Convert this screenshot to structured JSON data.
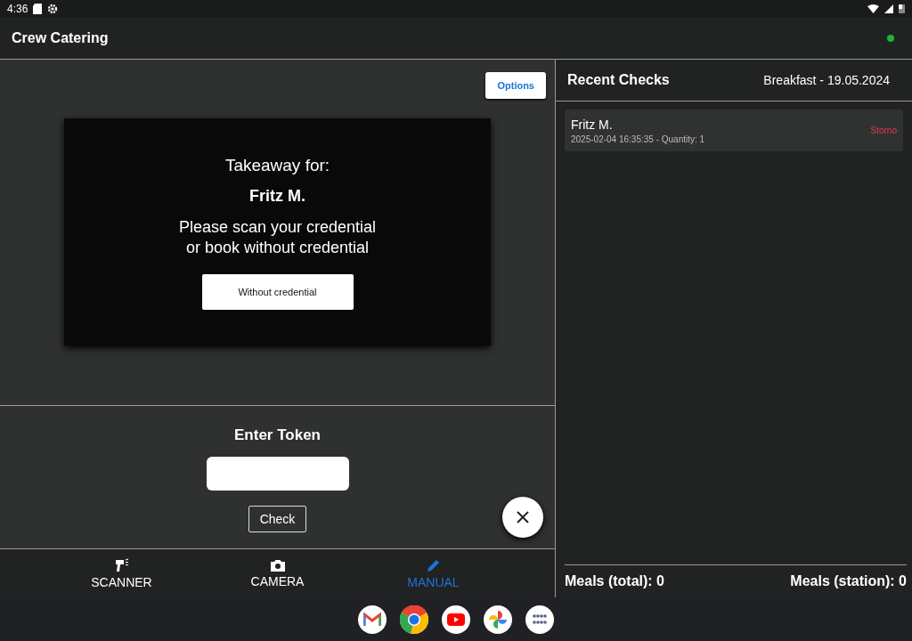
{
  "status_bar": {
    "time": "4:36"
  },
  "app_bar": {
    "title": "Crew Catering",
    "connected": true
  },
  "options_button": "Options",
  "dialog": {
    "heading": "Takeaway for:",
    "name": "Fritz M.",
    "message_lines": [
      "Please scan your credential",
      "or book without credential"
    ],
    "button": "Without credential"
  },
  "token": {
    "heading": "Enter Token",
    "button": "Check"
  },
  "nav": [
    {
      "kind": "scanner",
      "label": "SCANNER",
      "selected": false
    },
    {
      "kind": "camera",
      "label": "CAMERA",
      "selected": false
    },
    {
      "kind": "manual",
      "label": "MANUAL",
      "selected": true
    }
  ],
  "recent": {
    "title": "Recent Checks",
    "meal": "Breakfast  - 19.05.2024",
    "items": [
      {
        "name": "Fritz M.",
        "detail": "2025-02-04 16:35:35  - Quantity: 1",
        "action": "Storno"
      }
    ],
    "total": "Meals (total): 0",
    "station": "Meals (station): 0"
  },
  "dock": [
    {
      "kind": "mail"
    },
    {
      "kind": "browser"
    },
    {
      "kind": "video"
    },
    {
      "kind": "photos"
    },
    {
      "kind": "apps"
    }
  ]
}
